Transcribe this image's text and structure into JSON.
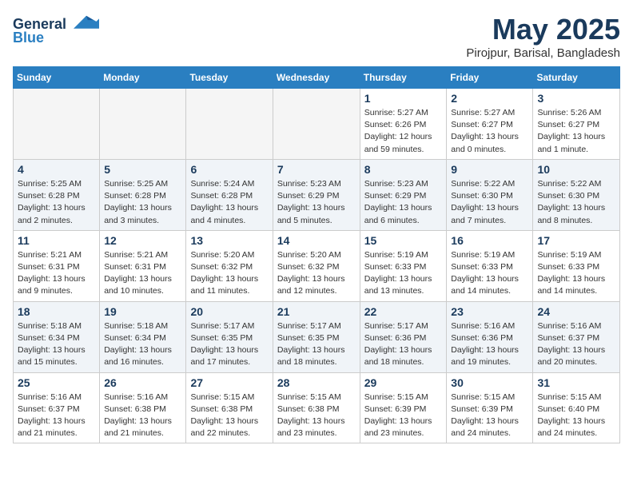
{
  "logo": {
    "line1": "General",
    "line2": "Blue"
  },
  "title": {
    "month_year": "May 2025",
    "location": "Pirojpur, Barisal, Bangladesh"
  },
  "weekdays": [
    "Sunday",
    "Monday",
    "Tuesday",
    "Wednesday",
    "Thursday",
    "Friday",
    "Saturday"
  ],
  "weeks": [
    [
      {
        "day": "",
        "info": ""
      },
      {
        "day": "",
        "info": ""
      },
      {
        "day": "",
        "info": ""
      },
      {
        "day": "",
        "info": ""
      },
      {
        "day": "1",
        "info": "Sunrise: 5:27 AM\nSunset: 6:26 PM\nDaylight: 12 hours and 59 minutes."
      },
      {
        "day": "2",
        "info": "Sunrise: 5:27 AM\nSunset: 6:27 PM\nDaylight: 13 hours and 0 minutes."
      },
      {
        "day": "3",
        "info": "Sunrise: 5:26 AM\nSunset: 6:27 PM\nDaylight: 13 hours and 1 minute."
      }
    ],
    [
      {
        "day": "4",
        "info": "Sunrise: 5:25 AM\nSunset: 6:28 PM\nDaylight: 13 hours and 2 minutes."
      },
      {
        "day": "5",
        "info": "Sunrise: 5:25 AM\nSunset: 6:28 PM\nDaylight: 13 hours and 3 minutes."
      },
      {
        "day": "6",
        "info": "Sunrise: 5:24 AM\nSunset: 6:28 PM\nDaylight: 13 hours and 4 minutes."
      },
      {
        "day": "7",
        "info": "Sunrise: 5:23 AM\nSunset: 6:29 PM\nDaylight: 13 hours and 5 minutes."
      },
      {
        "day": "8",
        "info": "Sunrise: 5:23 AM\nSunset: 6:29 PM\nDaylight: 13 hours and 6 minutes."
      },
      {
        "day": "9",
        "info": "Sunrise: 5:22 AM\nSunset: 6:30 PM\nDaylight: 13 hours and 7 minutes."
      },
      {
        "day": "10",
        "info": "Sunrise: 5:22 AM\nSunset: 6:30 PM\nDaylight: 13 hours and 8 minutes."
      }
    ],
    [
      {
        "day": "11",
        "info": "Sunrise: 5:21 AM\nSunset: 6:31 PM\nDaylight: 13 hours and 9 minutes."
      },
      {
        "day": "12",
        "info": "Sunrise: 5:21 AM\nSunset: 6:31 PM\nDaylight: 13 hours and 10 minutes."
      },
      {
        "day": "13",
        "info": "Sunrise: 5:20 AM\nSunset: 6:32 PM\nDaylight: 13 hours and 11 minutes."
      },
      {
        "day": "14",
        "info": "Sunrise: 5:20 AM\nSunset: 6:32 PM\nDaylight: 13 hours and 12 minutes."
      },
      {
        "day": "15",
        "info": "Sunrise: 5:19 AM\nSunset: 6:33 PM\nDaylight: 13 hours and 13 minutes."
      },
      {
        "day": "16",
        "info": "Sunrise: 5:19 AM\nSunset: 6:33 PM\nDaylight: 13 hours and 14 minutes."
      },
      {
        "day": "17",
        "info": "Sunrise: 5:19 AM\nSunset: 6:33 PM\nDaylight: 13 hours and 14 minutes."
      }
    ],
    [
      {
        "day": "18",
        "info": "Sunrise: 5:18 AM\nSunset: 6:34 PM\nDaylight: 13 hours and 15 minutes."
      },
      {
        "day": "19",
        "info": "Sunrise: 5:18 AM\nSunset: 6:34 PM\nDaylight: 13 hours and 16 minutes."
      },
      {
        "day": "20",
        "info": "Sunrise: 5:17 AM\nSunset: 6:35 PM\nDaylight: 13 hours and 17 minutes."
      },
      {
        "day": "21",
        "info": "Sunrise: 5:17 AM\nSunset: 6:35 PM\nDaylight: 13 hours and 18 minutes."
      },
      {
        "day": "22",
        "info": "Sunrise: 5:17 AM\nSunset: 6:36 PM\nDaylight: 13 hours and 18 minutes."
      },
      {
        "day": "23",
        "info": "Sunrise: 5:16 AM\nSunset: 6:36 PM\nDaylight: 13 hours and 19 minutes."
      },
      {
        "day": "24",
        "info": "Sunrise: 5:16 AM\nSunset: 6:37 PM\nDaylight: 13 hours and 20 minutes."
      }
    ],
    [
      {
        "day": "25",
        "info": "Sunrise: 5:16 AM\nSunset: 6:37 PM\nDaylight: 13 hours and 21 minutes."
      },
      {
        "day": "26",
        "info": "Sunrise: 5:16 AM\nSunset: 6:38 PM\nDaylight: 13 hours and 21 minutes."
      },
      {
        "day": "27",
        "info": "Sunrise: 5:15 AM\nSunset: 6:38 PM\nDaylight: 13 hours and 22 minutes."
      },
      {
        "day": "28",
        "info": "Sunrise: 5:15 AM\nSunset: 6:38 PM\nDaylight: 13 hours and 23 minutes."
      },
      {
        "day": "29",
        "info": "Sunrise: 5:15 AM\nSunset: 6:39 PM\nDaylight: 13 hours and 23 minutes."
      },
      {
        "day": "30",
        "info": "Sunrise: 5:15 AM\nSunset: 6:39 PM\nDaylight: 13 hours and 24 minutes."
      },
      {
        "day": "31",
        "info": "Sunrise: 5:15 AM\nSunset: 6:40 PM\nDaylight: 13 hours and 24 minutes."
      }
    ]
  ]
}
